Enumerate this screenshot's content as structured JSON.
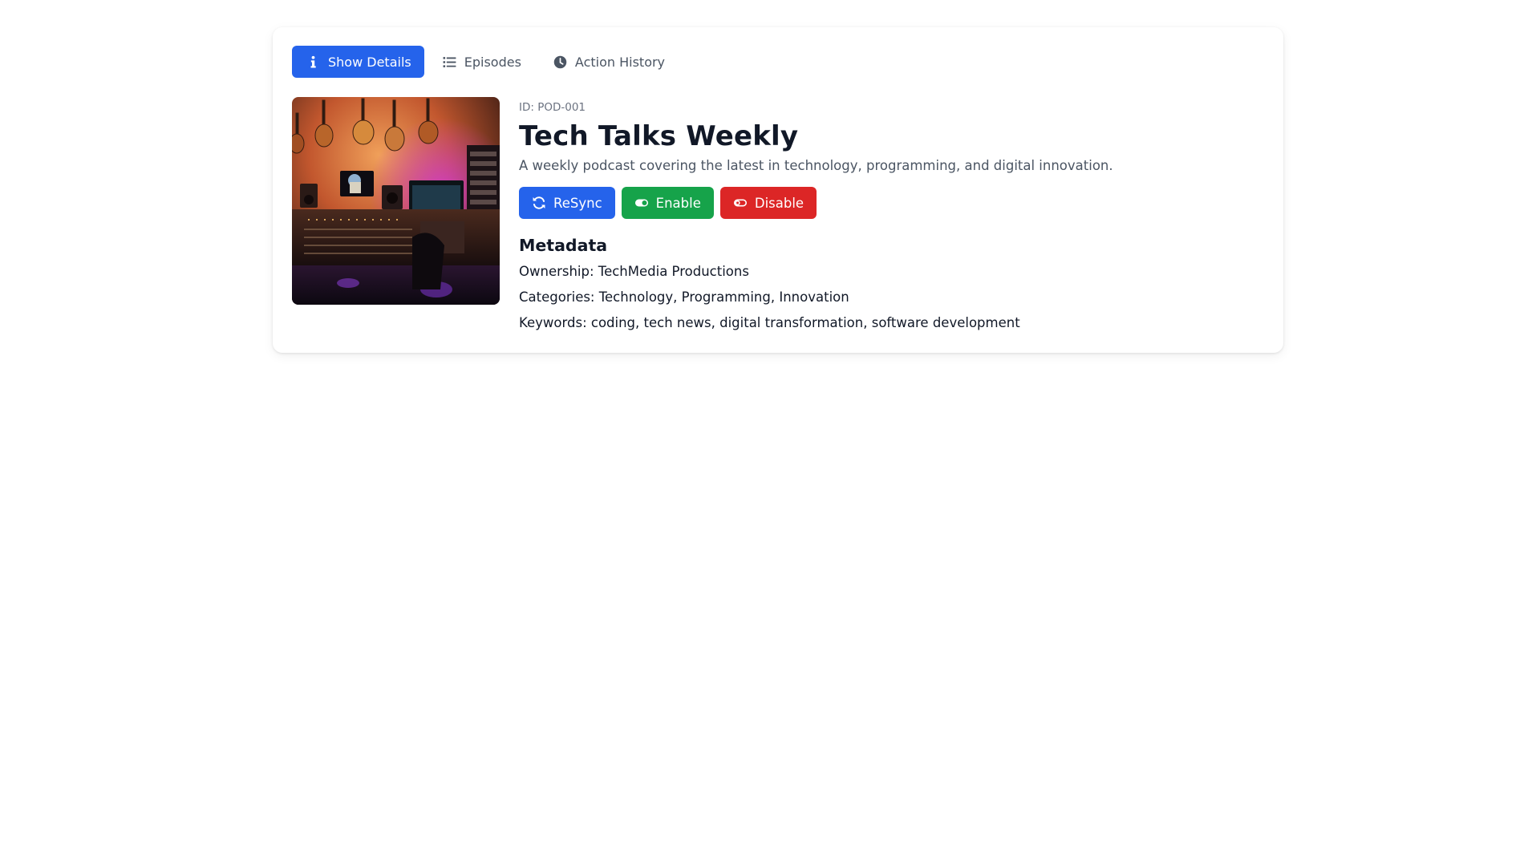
{
  "tabs": [
    {
      "label": "Show Details",
      "icon": "info-icon",
      "active": true
    },
    {
      "label": "Episodes",
      "icon": "list-icon",
      "active": false
    },
    {
      "label": "Action History",
      "icon": "clock-icon",
      "active": false
    }
  ],
  "podcast": {
    "id_text": "ID: POD-001",
    "title": "Tech Talks Weekly",
    "description": "A weekly podcast covering the latest in technology, programming, and digital innovation.",
    "cover_icon": "studio-cover-image"
  },
  "actions": {
    "resync_label": "ReSync",
    "enable_label": "Enable",
    "disable_label": "Disable"
  },
  "metadata": {
    "heading": "Metadata",
    "ownership": "Ownership: TechMedia Productions",
    "categories": "Categories: Technology, Programming, Innovation",
    "keywords": "Keywords: coding, tech news, digital transformation, software development"
  },
  "colors": {
    "primary": "#2563eb",
    "success": "#16a34a",
    "danger": "#dc2626"
  }
}
